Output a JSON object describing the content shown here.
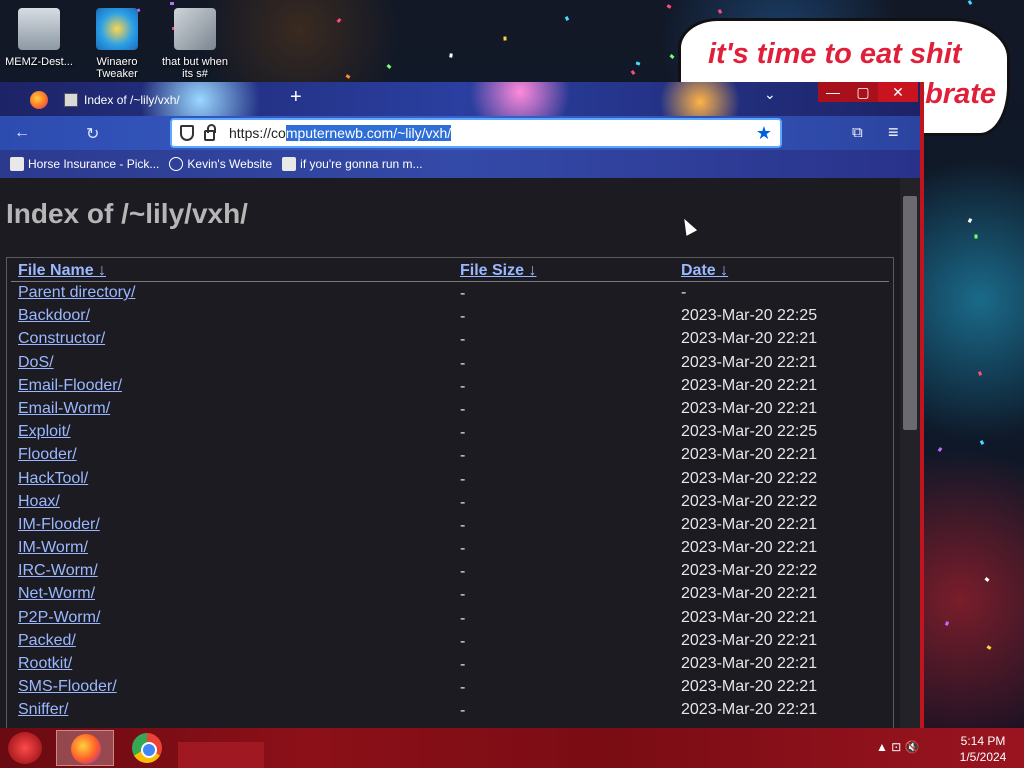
{
  "desktop": {
    "icons": [
      {
        "label": "MEMZ-Dest...",
        "icon": "recycle-bin"
      },
      {
        "label": "Winaero Tweaker",
        "icon": "winaero-tweaker"
      },
      {
        "label": "that but when its s#",
        "icon": "shortcut-stack"
      }
    ],
    "speech_bubble": {
      "line1": "it's time to eat shit",
      "line2": "ebrate"
    }
  },
  "browser": {
    "tab_title": "Index of /~lily/vxh/",
    "new_tab": "+",
    "tabs_dropdown": "⌄",
    "window_buttons": {
      "minimize": "—",
      "maximize": "▢",
      "close": "✕"
    },
    "url_prefix": "https://co",
    "url_selected": "mputernewb.com/~lily/vxh/",
    "bookmarks": [
      {
        "label": "Horse Insurance - Pick..."
      },
      {
        "label": "Kevin's Website"
      },
      {
        "label": "if you're gonna run m..."
      }
    ]
  },
  "page": {
    "title": "Index of /~lily/vxh/",
    "columns": {
      "name": "File Name  ↓ ",
      "size": "File Size  ↓ ",
      "date": "Date  ↓ "
    },
    "rows": [
      {
        "name": "Parent directory/",
        "size": "-",
        "date": "-"
      },
      {
        "name": "Backdoor/",
        "size": "-",
        "date": "2023-Mar-20 22:25"
      },
      {
        "name": "Constructor/",
        "size": "-",
        "date": "2023-Mar-20 22:21"
      },
      {
        "name": "DoS/",
        "size": "-",
        "date": "2023-Mar-20 22:21"
      },
      {
        "name": "Email-Flooder/",
        "size": "-",
        "date": "2023-Mar-20 22:21"
      },
      {
        "name": "Email-Worm/",
        "size": "-",
        "date": "2023-Mar-20 22:21"
      },
      {
        "name": "Exploit/",
        "size": "-",
        "date": "2023-Mar-20 22:25"
      },
      {
        "name": "Flooder/",
        "size": "-",
        "date": "2023-Mar-20 22:21"
      },
      {
        "name": "HackTool/",
        "size": "-",
        "date": "2023-Mar-20 22:22"
      },
      {
        "name": "Hoax/",
        "size": "-",
        "date": "2023-Mar-20 22:22"
      },
      {
        "name": "IM-Flooder/",
        "size": "-",
        "date": "2023-Mar-20 22:21"
      },
      {
        "name": "IM-Worm/",
        "size": "-",
        "date": "2023-Mar-20 22:21"
      },
      {
        "name": "IRC-Worm/",
        "size": "-",
        "date": "2023-Mar-20 22:22"
      },
      {
        "name": "Net-Worm/",
        "size": "-",
        "date": "2023-Mar-20 22:21"
      },
      {
        "name": "P2P-Worm/",
        "size": "-",
        "date": "2023-Mar-20 22:21"
      },
      {
        "name": "Packed/",
        "size": "-",
        "date": "2023-Mar-20 22:21"
      },
      {
        "name": "Rootkit/",
        "size": "-",
        "date": "2023-Mar-20 22:21"
      },
      {
        "name": "SMS-Flooder/",
        "size": "-",
        "date": "2023-Mar-20 22:21"
      },
      {
        "name": "Sniffer/",
        "size": "-",
        "date": "2023-Mar-20 22:21"
      }
    ]
  },
  "taskbar": {
    "apps": [
      "firefox",
      "chrome"
    ],
    "tray": "▲  ⊡  🔇",
    "time": "5:14 PM",
    "date": "1/5/2024"
  },
  "colors": {
    "link": "#9ab8ff",
    "accent_red": "#c0141f",
    "page_bg": "#1c1b22",
    "url_selection": "#2e6ed6"
  }
}
